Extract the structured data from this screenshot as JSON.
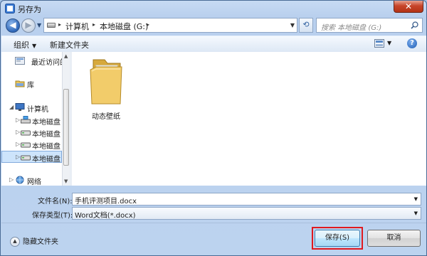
{
  "window": {
    "title": "另存为",
    "close_label": "✕"
  },
  "address": {
    "crumbs": [
      "计算机",
      "本地磁盘 (G:)"
    ],
    "separator": "▸"
  },
  "search": {
    "placeholder": "搜索 本地磁盘 (G:)"
  },
  "toolbar": {
    "organize": "组织",
    "new_folder": "新建文件夹",
    "help": "?"
  },
  "nav": {
    "items": [
      {
        "label": "最近访问的"
      },
      {
        "label": "库"
      },
      {
        "label": "计算机"
      },
      {
        "label": "本地磁盘"
      },
      {
        "label": "本地磁盘"
      },
      {
        "label": "本地磁盘"
      },
      {
        "label": "本地磁盘"
      },
      {
        "label": "网络"
      }
    ]
  },
  "files": [
    {
      "name": "动态壁纸",
      "type": "folder"
    }
  ],
  "form": {
    "filename_label": "文件名(N):",
    "filename_value": "手机评测项目.docx",
    "filetype_label": "保存类型(T):",
    "filetype_value": "Word文档(*.docx)"
  },
  "footer": {
    "hide_folders": "隐藏文件夹",
    "save": "保存(S)",
    "cancel": "取消"
  },
  "colors": {
    "accent": "#2d66b8",
    "highlight": "#e0191f",
    "selection": "#cde4fb"
  }
}
